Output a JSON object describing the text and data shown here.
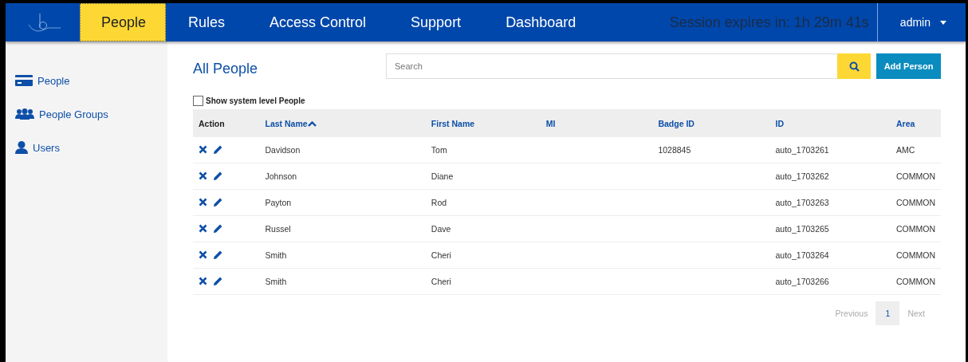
{
  "nav": {
    "tabs": [
      {
        "label": "People",
        "selected": true
      },
      {
        "label": "Rules",
        "selected": false
      },
      {
        "label": "Access Control",
        "selected": false
      },
      {
        "label": "Support",
        "selected": false
      },
      {
        "label": "Dashboard",
        "selected": false
      }
    ],
    "session": "Session expires in: 1h 29m 41s",
    "user": "admin"
  },
  "sidebar": {
    "items": [
      {
        "kind": "card",
        "label": "People"
      },
      {
        "kind": "group",
        "label": "People Groups"
      },
      {
        "kind": "user",
        "label": "Users"
      }
    ]
  },
  "title": "All People",
  "search": {
    "placeholder": "Search"
  },
  "add_button": "Add Person",
  "show_system": {
    "label": "Show system level People",
    "checked": false
  },
  "table": {
    "columns": [
      {
        "label": "Action",
        "sortable": false
      },
      {
        "label": "Last Name",
        "sortable": true,
        "sorted_ascending": true
      },
      {
        "label": "First Name",
        "sortable": true
      },
      {
        "label": "MI",
        "sortable": true
      },
      {
        "label": "Badge ID",
        "sortable": true
      },
      {
        "label": "ID",
        "sortable": true
      },
      {
        "label": "Area",
        "sortable": true
      }
    ],
    "rows": [
      [
        "",
        "Davidson",
        "Tom",
        "",
        "1028845",
        "auto_1703261",
        "AMC"
      ],
      [
        "",
        "Johnson",
        "Diane",
        "",
        "",
        "auto_1703262",
        "COMMON"
      ],
      [
        "",
        "Payton",
        "Rod",
        "",
        "",
        "auto_1703263",
        "COMMON"
      ],
      [
        "",
        "Russel",
        "Dave",
        "",
        "",
        "auto_1703265",
        "COMMON"
      ],
      [
        "",
        "Smith",
        "Cheri",
        "",
        "",
        "auto_1703264",
        "COMMON"
      ],
      [
        "",
        "Smith",
        "Cheri",
        "",
        "",
        "auto_1703266",
        "COMMON"
      ]
    ]
  },
  "pagination": {
    "previous": {
      "label": "Previous",
      "disabled": true
    },
    "pages": [
      {
        "label": "1",
        "selected": true
      }
    ],
    "next": {
      "label": "Next",
      "disabled": true
    }
  }
}
